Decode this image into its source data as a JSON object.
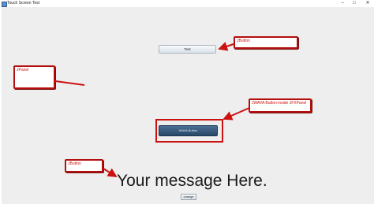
{
  "window": {
    "title": "Touch Screen Test",
    "controls": {
      "minimize": "–",
      "maximize": "□",
      "close": "✕"
    }
  },
  "main": {
    "test_button_label": "Test",
    "panel_label": "WAVA Button",
    "message": "Your message Here.",
    "change_button_label": "change"
  },
  "annotations": {
    "jbutton_top": "JButton",
    "jpanel": "JPanel",
    "wavy_panel": "JWAVA Button inside JFXPanel",
    "jbutton_bottom": "JButton"
  },
  "colors": {
    "annotation_red": "#cc1111",
    "panel_blue": "#294868",
    "window_bg": "#eeeeee"
  }
}
